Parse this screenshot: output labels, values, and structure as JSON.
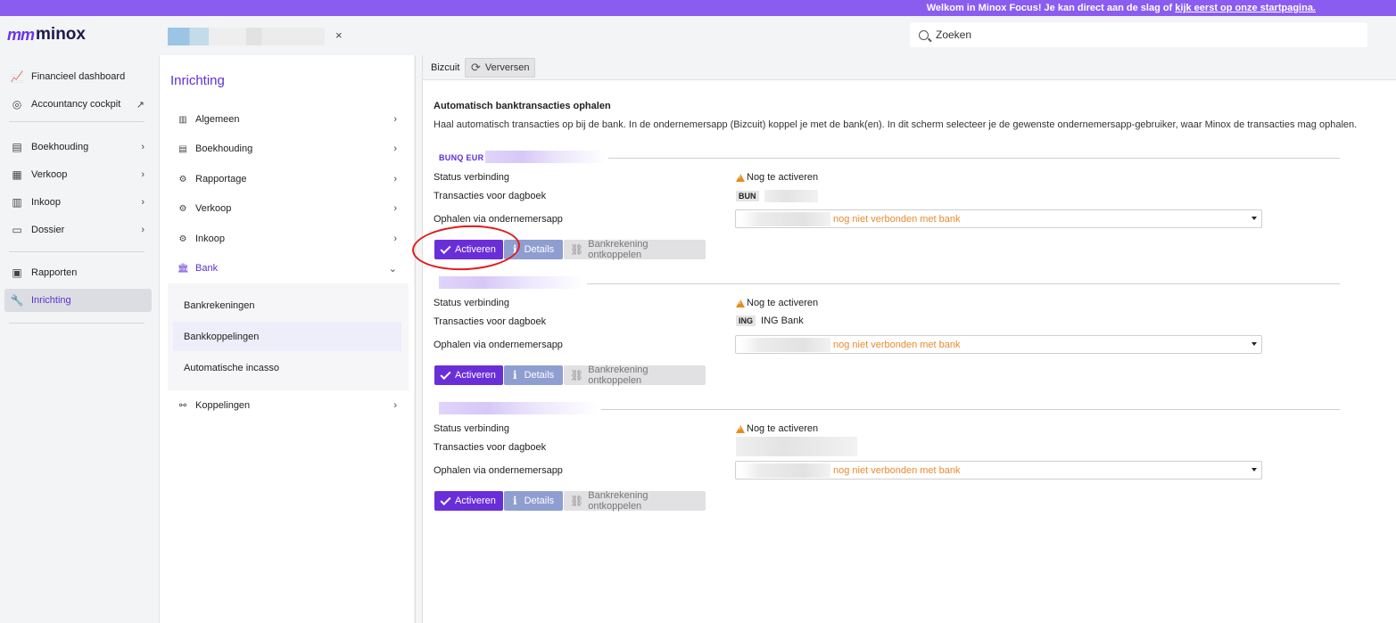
{
  "banner": {
    "text": "Welkom in Minox Focus! Je kan direct aan de slag of ",
    "link": "kijk eerst op onze startpagina."
  },
  "header": {
    "logo_mark": "m",
    "logo_text": "minox",
    "tab_close": "×",
    "search_placeholder": "Zoeken"
  },
  "sidebar": {
    "items": [
      {
        "label": "Financieel dashboard",
        "icon": "chart-icon"
      },
      {
        "label": "Accountancy cockpit",
        "icon": "gauge-icon",
        "external": "↗"
      },
      {
        "label": "Boekhouding",
        "icon": "book-icon",
        "chev": "›"
      },
      {
        "label": "Verkoop",
        "icon": "abacus-icon",
        "chev": "›"
      },
      {
        "label": "Inkoop",
        "icon": "receipt-icon",
        "chev": "›"
      },
      {
        "label": "Dossier",
        "icon": "folder-icon",
        "chev": "›"
      },
      {
        "label": "Rapporten",
        "icon": "report-icon"
      },
      {
        "label": "Inrichting",
        "icon": "wrench-icon"
      }
    ]
  },
  "midnav": {
    "title": "Inrichting",
    "items": [
      {
        "label": "Algemeen",
        "chev": "›"
      },
      {
        "label": "Boekhouding",
        "chev": "›"
      },
      {
        "label": "Rapportage",
        "chev": "›"
      },
      {
        "label": "Verkoop",
        "chev": "›"
      },
      {
        "label": "Inkoop",
        "chev": "›"
      },
      {
        "label": "Bank",
        "chev": "⌄"
      }
    ],
    "sub_items": [
      "Bankrekeningen",
      "Bankkoppelingen",
      "Automatische incasso"
    ],
    "last_item": {
      "label": "Koppelingen",
      "chev": "›"
    }
  },
  "toolbar": {
    "label": "Bizcuit",
    "refresh_label": "Verversen"
  },
  "content": {
    "title": "Automatisch banktransacties ophalen",
    "description": "Haal automatisch transacties op bij de bank. In de ondernemersapp (Bizcuit) koppel je met de bank(en). In dit scherm selecteer je de gewenste ondernemersapp-gebruiker, waar Minox de transacties mag ophalen.",
    "labels": {
      "status": "Status verbinding",
      "journal": "Transacties voor dagboek",
      "fetch": "Ophalen via ondernemersapp"
    },
    "buttons": {
      "activate": "Activeren",
      "details": "Details",
      "unlink": "Bankrekening ontkoppelen"
    },
    "accounts": [
      {
        "header": "BUNQ EUR",
        "status": "Nog te activeren",
        "journal_code": "BUN",
        "journal_name": "",
        "select_value": "nog niet verbonden met bank"
      },
      {
        "header": "",
        "status": "Nog te activeren",
        "journal_code": "ING",
        "journal_name": "ING Bank",
        "select_value": "nog niet verbonden met bank"
      },
      {
        "header": "",
        "status": "Nog te activeren",
        "journal_code": "",
        "journal_name": "",
        "select_value": "nog niet verbonden met bank"
      }
    ]
  },
  "colors": {
    "accent": "#6a2ed9",
    "banner": "#8a5cf0",
    "warning": "#e98a1d",
    "highlight": "#e01b1b"
  }
}
